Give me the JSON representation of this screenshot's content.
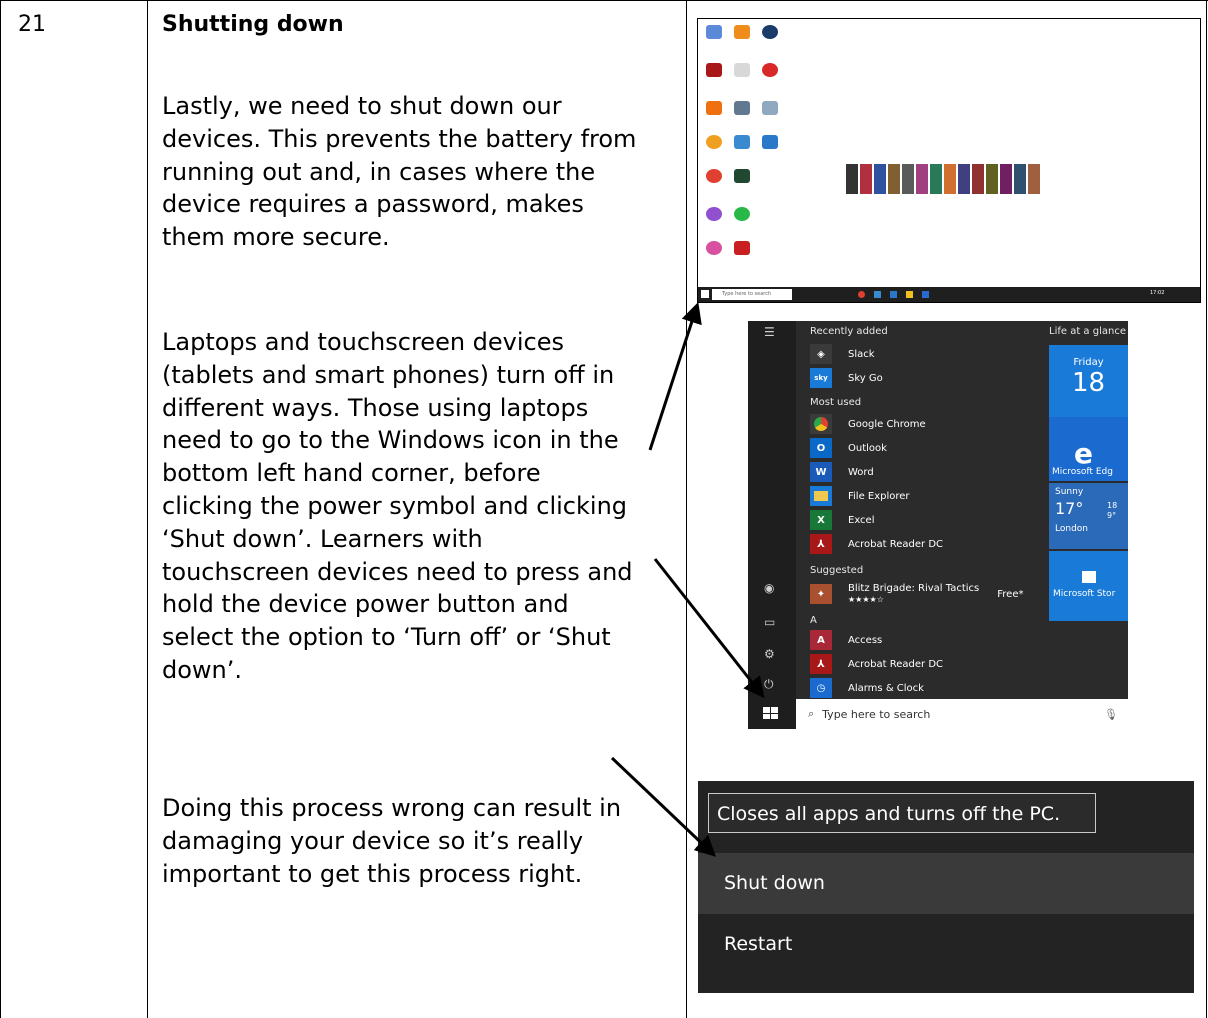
{
  "row": {
    "number": "21",
    "heading": "Shutting down",
    "paragraph1": [
      "Lastly, we need to shut down our",
      "devices. This prevents the battery from",
      "running out and, in cases where the",
      "device requires a password, makes",
      "them more secure."
    ],
    "paragraph2": [
      "Laptops and touchscreen devices",
      "(tablets and smart phones) turn off in",
      "different ways. Those using laptops",
      "need to go to the Windows icon in the",
      "bottom left hand corner, before",
      "clicking the power symbol and clicking",
      "‘Shut down’. Learners with",
      "touchscreen devices need to press and",
      "hold the device power button and",
      "select the option to ‘Turn off’ or ‘Shut",
      "down’."
    ],
    "paragraph3": [
      "Doing this process wrong can result in",
      "damaging your device so it’s really",
      "important to get this process right."
    ]
  },
  "desktop": {
    "taskbar_search": "Type here to search",
    "time": "17:02"
  },
  "start_menu": {
    "recently_added": "Recently added",
    "life_at_a_glance": "Life at a glance",
    "most_used": "Most used",
    "suggested": "Suggested",
    "section_a": "A",
    "apps": {
      "slack": "Slack",
      "sky_go": "Sky Go",
      "chrome": "Google Chrome",
      "outlook": "Outlook",
      "word": "Word",
      "file_explorer": "File Explorer",
      "excel": "Excel",
      "acrobat1": "Acrobat Reader DC",
      "blitz": "Blitz Brigade: Rival Tactics",
      "blitz_rating": "★★★★☆",
      "free": "Free*",
      "access": "Access",
      "acrobat2": "Acrobat Reader DC",
      "alarms": "Alarms & Clock"
    },
    "tiles": {
      "day": "Friday",
      "date": "18",
      "edge": "Microsoft Edg",
      "weather": "Sunny",
      "temp": "17°",
      "temp_hi": "18",
      "temp_lo": "9°",
      "city": "London",
      "store": "Microsoft Stor"
    },
    "search_placeholder": "Type here to search"
  },
  "power_menu": {
    "tooltip": "Closes all apps and turns off the PC.",
    "shut_down": "Shut down",
    "restart": "Restart"
  }
}
